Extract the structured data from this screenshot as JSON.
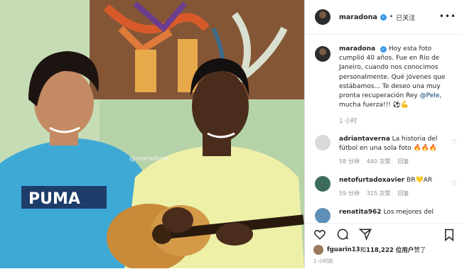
{
  "post": {
    "watermark": "@maradona"
  },
  "header": {
    "username": "maradona",
    "verified_mark": "✓",
    "separator": "•",
    "follow_label": "已关注",
    "more_label": "•••"
  },
  "caption": {
    "username": "maradona",
    "text": "Hoy esta foto cumplió 40 años. Fue en Río de Janeiro, cuando nos conocimos personalmente. Qué jóvenes que estábamos... Te deseo una muy pronta recuperación Rey ",
    "mention": "@Pele",
    "text_end": ", mucha fuerza!!! ⚽💪",
    "time": "1 小时"
  },
  "comments": [
    {
      "username": "adriantaverna",
      "text": "La historia del fútbol en una sola foto 🔥🔥🔥",
      "time": "58 分钟",
      "likes": "440 次赞",
      "reply": "回复"
    },
    {
      "username": "netofurtadoxavier",
      "text": "BR💛AR",
      "time": "59 分钟",
      "likes": "315 次赞",
      "reply": "回复"
    },
    {
      "username": "renatita962",
      "text": "Los mejores del",
      "time": "",
      "likes": "",
      "reply": ""
    }
  ],
  "actions": {
    "liker": "fguarin13",
    "likes_prefix": " 和 ",
    "likes_count": "118,222 位用户",
    "likes_suffix": " 赞了",
    "time_ago": "1 小时前"
  },
  "colors": {
    "accent": "#3897f0",
    "link": "#003569",
    "muted": "#8e8e8e",
    "text": "#262626"
  }
}
